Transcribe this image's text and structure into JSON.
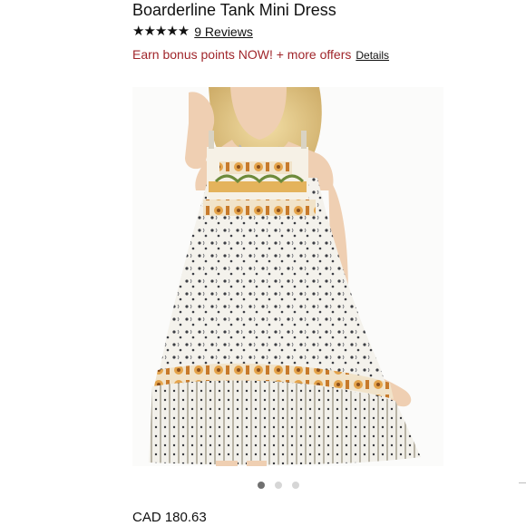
{
  "product": {
    "title": "Boarderline Tank Mini Dress",
    "stars": "★★★★★",
    "reviews_link": "9 Reviews",
    "price": "CAD 180.63"
  },
  "promo": {
    "offer_text": "Earn bonus points NOW! + more offers",
    "details_link": "Details",
    "offer_color": "#a0262b"
  },
  "carousel": {
    "slides": 3,
    "active_index": 0,
    "image_alt": "model wearing printed tank mini dress"
  }
}
